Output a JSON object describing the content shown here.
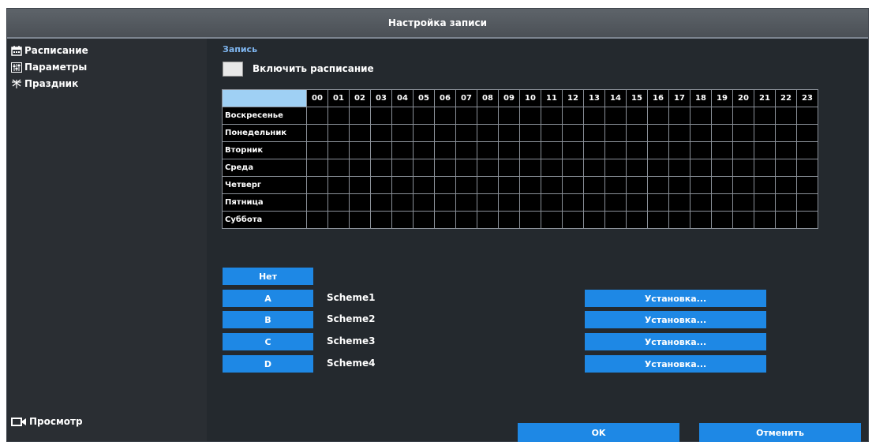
{
  "window": {
    "title": "Настройка записи"
  },
  "sidebar": {
    "items": [
      {
        "label": "Расписание",
        "icon": "calendar-icon"
      },
      {
        "label": "Параметры",
        "icon": "parameters-icon"
      },
      {
        "label": "Праздник",
        "icon": "holiday-icon"
      }
    ],
    "footer": {
      "label": "Просмотр",
      "icon": "camera-icon"
    }
  },
  "main": {
    "section_title": "Запись",
    "enable_label": "Включить расписание",
    "grid": {
      "hours": [
        "00",
        "01",
        "02",
        "03",
        "04",
        "05",
        "06",
        "07",
        "08",
        "09",
        "10",
        "11",
        "12",
        "13",
        "14",
        "15",
        "16",
        "17",
        "18",
        "19",
        "20",
        "21",
        "22",
        "23"
      ],
      "days": [
        "Воскресенье",
        "Понедельник",
        "Вторник",
        "Среда",
        "Четверг",
        "Пятница",
        "Суббота"
      ]
    },
    "none_button": "Нет",
    "schemes": [
      {
        "button": "A",
        "name": "Scheme1",
        "setup": "Установка..."
      },
      {
        "button": "B",
        "name": "Scheme2",
        "setup": "Установка..."
      },
      {
        "button": "C",
        "name": "Scheme3",
        "setup": "Установка..."
      },
      {
        "button": "D",
        "name": "Scheme4",
        "setup": "Установка..."
      }
    ]
  },
  "footer": {
    "ok": "OK",
    "cancel": "Отменить"
  },
  "colors": {
    "accent": "#1e88e5",
    "link": "#7fb6f0",
    "grid_corner": "#9fd0f4"
  }
}
